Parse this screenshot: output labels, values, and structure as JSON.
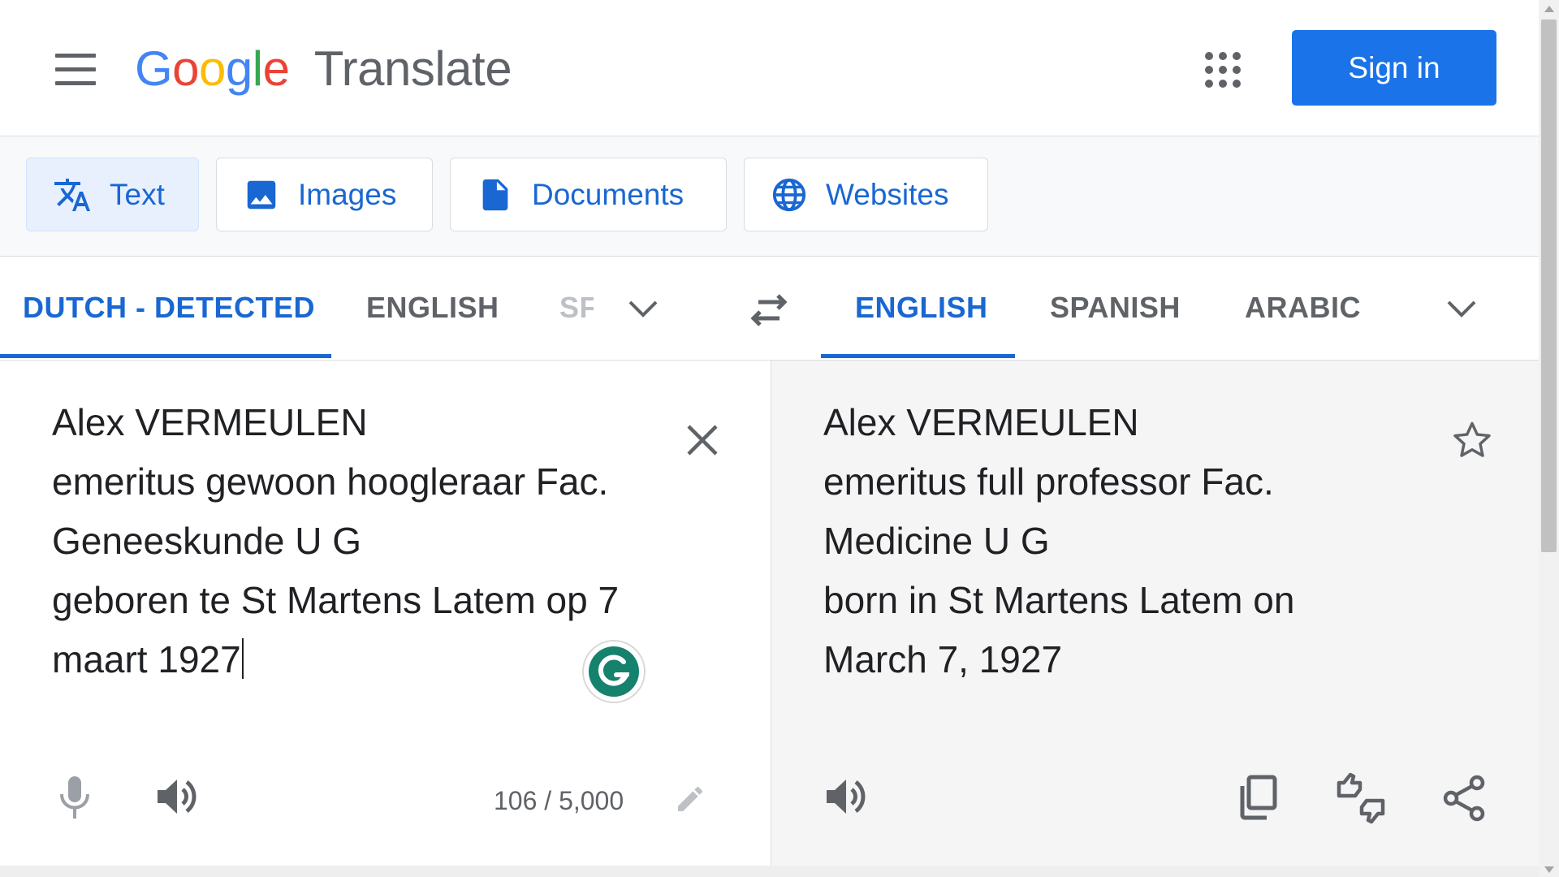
{
  "header": {
    "logo_letters": [
      {
        "char": "G",
        "color": "#4285f4"
      },
      {
        "char": "o",
        "color": "#ea4335"
      },
      {
        "char": "o",
        "color": "#fbbc04"
      },
      {
        "char": "g",
        "color": "#4285f4"
      },
      {
        "char": "l",
        "color": "#34a853"
      },
      {
        "char": "e",
        "color": "#ea4335"
      }
    ],
    "product_name": "Translate",
    "menu_icon": "hamburger-icon",
    "apps_icon": "apps-grid-icon",
    "sign_in_label": "Sign in"
  },
  "modes": [
    {
      "label": "Text",
      "icon": "translate-icon",
      "active": true
    },
    {
      "label": "Images",
      "icon": "image-icon",
      "active": false
    },
    {
      "label": "Documents",
      "icon": "document-icon",
      "active": false
    },
    {
      "label": "Websites",
      "icon": "globe-icon",
      "active": false
    }
  ],
  "source_languages": [
    {
      "label": "DUTCH - DETECTED",
      "active": true
    },
    {
      "label": "ENGLISH",
      "active": false
    },
    {
      "label": "SF",
      "active": false
    }
  ],
  "target_languages": [
    {
      "label": "ENGLISH",
      "active": true
    },
    {
      "label": "SPANISH",
      "active": false
    },
    {
      "label": "ARABIC",
      "active": false
    }
  ],
  "swap_icon": "swap-arrows-icon",
  "source": {
    "lines": [
      "Alex VERMEULEN",
      "emeritus gewoon hoogleraar Fac.",
      "Geneeskunde U G",
      "geboren te St Martens Latem op 7",
      "maart 1927"
    ],
    "char_count": "106 / 5,000"
  },
  "target": {
    "lines": [
      "Alex VERMEULEN",
      "emeritus full professor Fac.",
      "Medicine U G",
      "born in St Martens Latem on",
      "March 7, 1927"
    ]
  },
  "colors": {
    "accent": "#1a73e8",
    "active_text": "#1967d2",
    "icon_gray": "#5f6368",
    "grammarly_green": "#15826d"
  }
}
